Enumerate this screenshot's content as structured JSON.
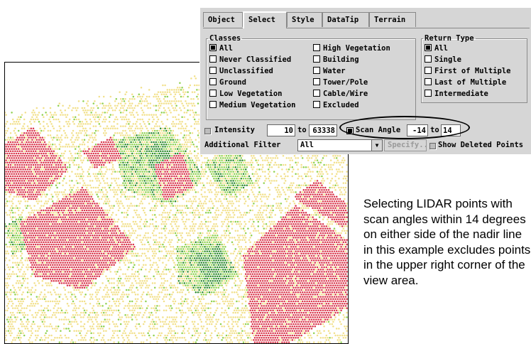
{
  "tabs": [
    {
      "label": "Object"
    },
    {
      "label": "Select"
    },
    {
      "label": "Style"
    },
    {
      "label": "DataTip"
    },
    {
      "label": "Terrain"
    }
  ],
  "active_tab": "Select",
  "classes": {
    "legend": "Classes",
    "items": [
      {
        "label": "All",
        "checked": true
      },
      {
        "label": "Never Classified",
        "checked": false
      },
      {
        "label": "Unclassified",
        "checked": false
      },
      {
        "label": "Ground",
        "checked": false
      },
      {
        "label": "Low Vegetation",
        "checked": false
      },
      {
        "label": "Medium Vegetation",
        "checked": false
      },
      {
        "label": "High Vegetation",
        "checked": false
      },
      {
        "label": "Building",
        "checked": false
      },
      {
        "label": "Water",
        "checked": false
      },
      {
        "label": "Tower/Pole",
        "checked": false
      },
      {
        "label": "Cable/Wire",
        "checked": false
      },
      {
        "label": "Excluded",
        "checked": false
      }
    ]
  },
  "return_type": {
    "legend": "Return Type",
    "items": [
      {
        "label": "All",
        "checked": true
      },
      {
        "label": "Single",
        "checked": false
      },
      {
        "label": "First of Multiple",
        "checked": false
      },
      {
        "label": "Last of Multiple",
        "checked": false
      },
      {
        "label": "Intermediate",
        "checked": false
      }
    ]
  },
  "intensity": {
    "label": "Intensity",
    "min": "10",
    "to": "to",
    "max": "63338",
    "enabled": false
  },
  "scan_angle": {
    "label": "Scan Angle",
    "min": "-14",
    "to": "to",
    "max": "14",
    "enabled": true
  },
  "additional_filter": {
    "label": "Additional Filter",
    "value": "All",
    "specify_label": "Specify..."
  },
  "show_deleted": {
    "label": "Show Deleted Points",
    "enabled": false
  },
  "caption": "Selecting LIDAR points with scan angles within 14 degrees on either side of the nadir line in this example excludes points in the upper right corner of the view area.",
  "colors": {
    "building": "#d9344a",
    "ground": "#f2e08a",
    "vegetation_low": "#8fd14f",
    "vegetation_high": "#2e8b2e",
    "panel": "#d6d6d6"
  }
}
